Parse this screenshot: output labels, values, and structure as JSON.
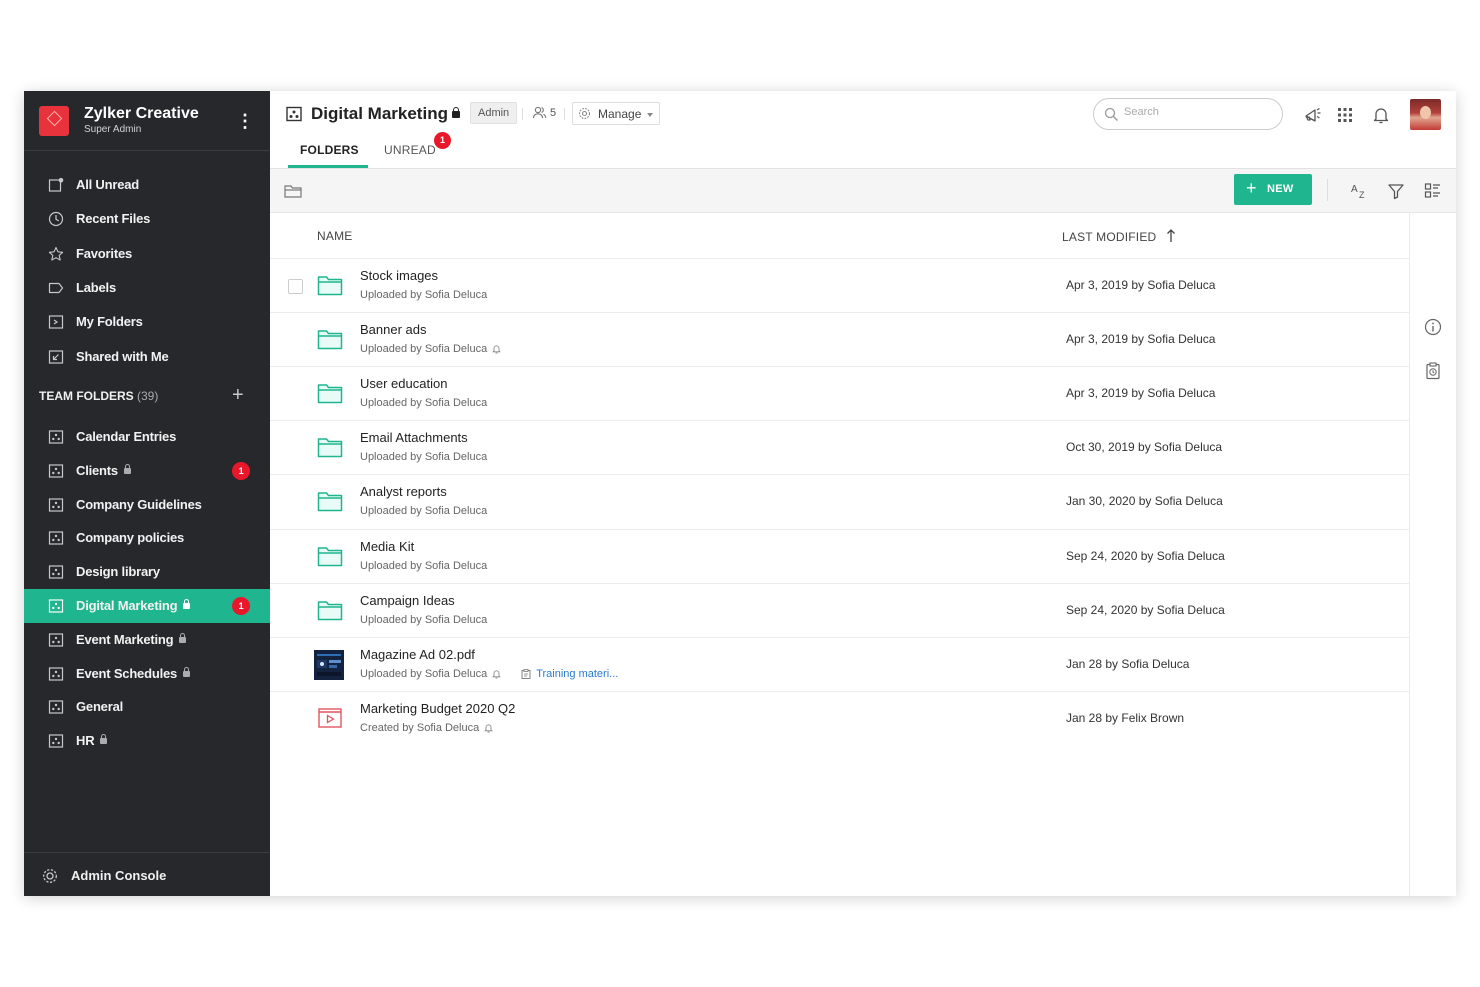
{
  "org": {
    "name": "Zylker Creative",
    "role": "Super Admin"
  },
  "sidebar": {
    "items": [
      {
        "label": "All Unread",
        "icon": "unread-icon"
      },
      {
        "label": "Recent Files",
        "icon": "clock-icon"
      },
      {
        "label": "Favorites",
        "icon": "star-icon"
      },
      {
        "label": "Labels",
        "icon": "label-icon"
      },
      {
        "label": "My Folders",
        "icon": "my-folders-icon"
      },
      {
        "label": "Shared with Me",
        "icon": "shared-icon"
      }
    ],
    "team_folders_label": "TEAM FOLDERS",
    "team_folders_count": "(39)",
    "team_folders": [
      {
        "label": "Calendar Entries",
        "locked": false,
        "badge": ""
      },
      {
        "label": "Clients",
        "locked": true,
        "badge": "1"
      },
      {
        "label": "Company Guidelines",
        "locked": false,
        "badge": ""
      },
      {
        "label": "Company policies",
        "locked": false,
        "badge": ""
      },
      {
        "label": "Design library",
        "locked": false,
        "badge": ""
      },
      {
        "label": "Digital Marketing",
        "locked": true,
        "badge": "1",
        "active": true
      },
      {
        "label": "Event Marketing",
        "locked": true,
        "badge": ""
      },
      {
        "label": "Event Schedules",
        "locked": true,
        "badge": ""
      },
      {
        "label": "General",
        "locked": false,
        "badge": ""
      },
      {
        "label": "HR",
        "locked": true,
        "badge": ""
      }
    ],
    "admin_console": "Admin Console"
  },
  "header": {
    "title": "Digital Marketing",
    "role_badge": "Admin",
    "members": "5",
    "manage": "Manage",
    "tabs": [
      {
        "label": "FOLDERS",
        "active": true
      },
      {
        "label": "UNREAD",
        "badge": "1"
      }
    ],
    "search_placeholder": "Search"
  },
  "toolbar": {
    "new_label": "NEW"
  },
  "columns": {
    "name": "NAME",
    "modified": "LAST MODIFIED"
  },
  "rows": [
    {
      "name": "Stock images",
      "sub": "Uploaded by Sofia Deluca",
      "bell": false,
      "modified": "Apr 3, 2019 by Sofia Deluca",
      "type": "folder"
    },
    {
      "name": "Banner ads",
      "sub": "Uploaded by Sofia Deluca",
      "bell": true,
      "modified": "Apr 3, 2019 by Sofia Deluca",
      "type": "folder"
    },
    {
      "name": "User education",
      "sub": "Uploaded by Sofia Deluca",
      "bell": false,
      "modified": "Apr 3, 2019 by Sofia Deluca",
      "type": "folder"
    },
    {
      "name": "Email Attachments",
      "sub": "Uploaded by Sofia Deluca",
      "bell": false,
      "modified": "Oct 30, 2019 by Sofia Deluca",
      "type": "folder"
    },
    {
      "name": "Analyst reports",
      "sub": "Uploaded by Sofia Deluca",
      "bell": false,
      "modified": "Jan 30, 2020 by Sofia Deluca",
      "type": "folder"
    },
    {
      "name": "Media Kit",
      "sub": "Uploaded by Sofia Deluca",
      "bell": false,
      "modified": "Sep 24, 2020 by Sofia Deluca",
      "type": "folder"
    },
    {
      "name": "Campaign Ideas",
      "sub": "Uploaded by Sofia Deluca",
      "bell": false,
      "modified": "Sep 24, 2020 by Sofia Deluca",
      "type": "folder"
    },
    {
      "name": "Magazine Ad 02.pdf",
      "sub": "Uploaded by Sofia Deluca",
      "bell": true,
      "tag": "Training materi...",
      "modified": "Jan 28 by Sofia Deluca",
      "type": "pdf"
    },
    {
      "name": "Marketing Budget 2020 Q2",
      "sub": "Created by Sofia Deluca",
      "bell": true,
      "modified": "Jan 28 by Felix Brown",
      "type": "presentation"
    }
  ],
  "colors": {
    "accent": "#1fb58f",
    "sidebar": "#26282b",
    "badge": "#e9172b",
    "brand": "#e8333d"
  }
}
